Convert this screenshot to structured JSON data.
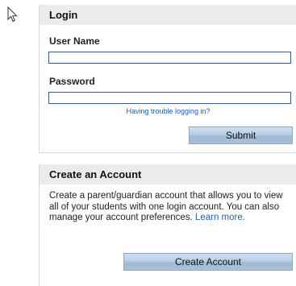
{
  "login": {
    "title": "Login",
    "username_label": "User Name",
    "username_value": "",
    "password_label": "Password",
    "password_value": "",
    "trouble_link": "Having trouble logging in?",
    "submit_label": "Submit"
  },
  "account": {
    "title": "Create an Account",
    "description": "Create a parent/guardian account that allows you to view all of your students with one login account. You can also manage your account preferences.",
    "learn_more": "Learn more.",
    "create_label": "Create Account"
  },
  "colors": {
    "header_bg": "#ebebeb",
    "link": "#1a5fb4",
    "button_bg": "#b8cfe4",
    "input_border": "#3d5a80"
  },
  "icons": {
    "cursor": "mouse-pointer-icon"
  }
}
